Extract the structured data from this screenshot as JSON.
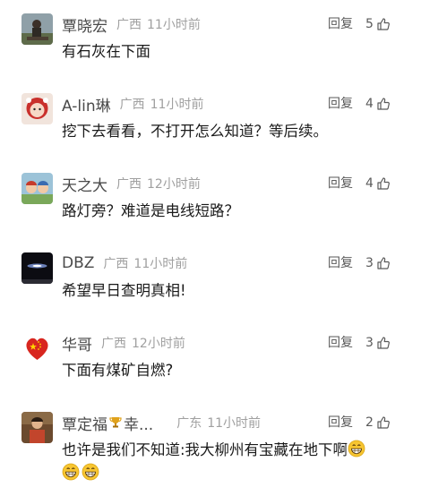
{
  "reply_label": "回复",
  "comments": [
    {
      "name": "覃晓宏",
      "region": "广西",
      "time": "11小时前",
      "likes": "5",
      "text": "有石灰在下面"
    },
    {
      "name": "A-lin琳",
      "region": "广西",
      "time": "11小时前",
      "likes": "4",
      "text": "挖下去看看，不打开怎么知道？等后续。"
    },
    {
      "name": "天之大",
      "region": "广西",
      "time": "12小时前",
      "likes": "4",
      "text": "路灯旁？难道是电线短路？"
    },
    {
      "name": "DBZ",
      "region": "广西",
      "time": "11小时前",
      "likes": "3",
      "text": "希望早日查明真相!"
    },
    {
      "name": "华哥",
      "region": "广西",
      "time": "12小时前",
      "likes": "3",
      "text": "下面有煤矿自燃?"
    },
    {
      "name_prefix": "覃定福",
      "name_suffix": "幸...",
      "region": "广东",
      "time": "11小时前",
      "likes": "2",
      "text": "也许是我们不知道:我大柳州有宝藏在地下啊"
    }
  ],
  "icons": {
    "like": "thumbs-up-icon",
    "emoji": "grinning-face-icon",
    "badge": "trophy-icon"
  },
  "colors": {
    "name": "#4a4a4a",
    "meta": "#a0a0a0",
    "text": "#1a1a1a"
  }
}
